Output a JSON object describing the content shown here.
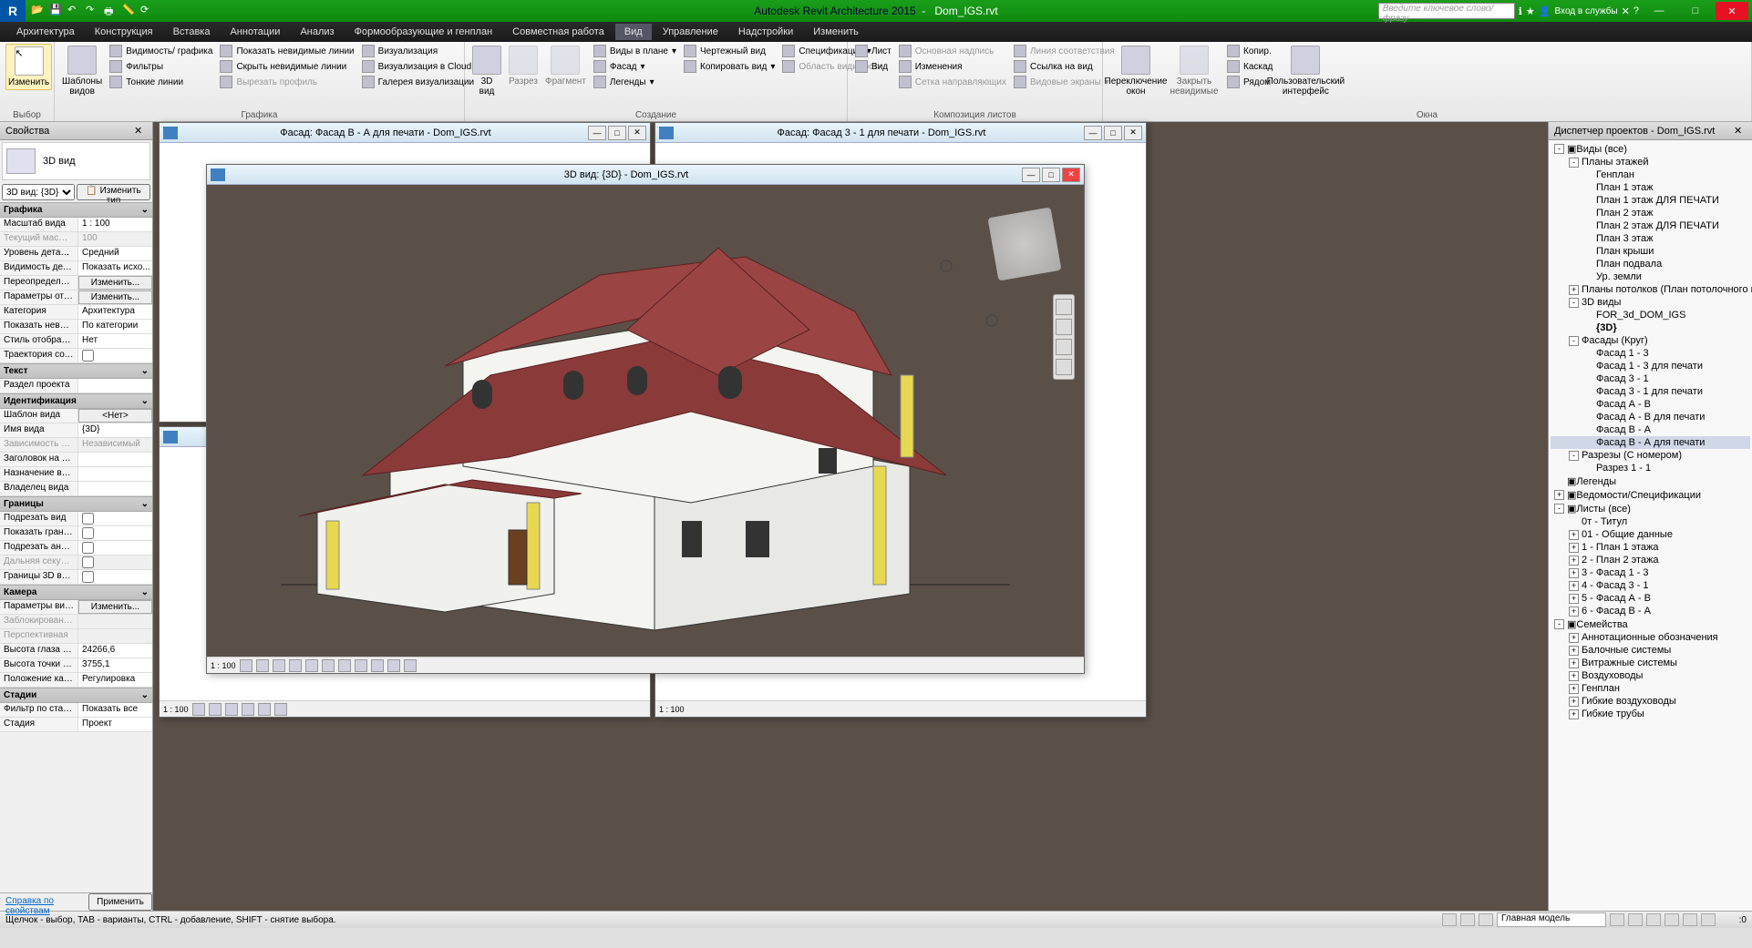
{
  "app": {
    "name": "Autodesk Revit Architecture 2015",
    "file": "Dom_IGS.rvt",
    "search_placeholder": "Введите ключевое слово/фразу",
    "login": "Вход в службы"
  },
  "menu": [
    "Архитектура",
    "Конструкция",
    "Вставка",
    "Аннотации",
    "Анализ",
    "Формообразующие и генплан",
    "Совместная работа",
    "Вид",
    "Управление",
    "Надстройки",
    "Изменить"
  ],
  "menu_active": "Вид",
  "ribbon": {
    "modify": "Изменить",
    "selector_label": "Выбор",
    "templates": "Шаблоны\nвидов",
    "graphics": {
      "label": "Графика",
      "vis_graphics": "Видимость/ графика",
      "filters": "Фильтры",
      "thin_lines": "Тонкие линии",
      "show_hidden": "Показать невидимые линии",
      "hide_hidden": "Скрыть невидимые линии",
      "cut_profile": "Вырезать профиль",
      "visualization": "Визуализация",
      "viz_cloud": "Визуализация  в Cloud",
      "gallery": "Галерея  визуализации"
    },
    "create": {
      "label": "Создание",
      "3d": "3D\nвид",
      "section": "Разрез",
      "fragment": "Фрагмент",
      "plan_views": "Виды в плане",
      "facade": "Фасад",
      "legends": "Легенды",
      "drafting": "Чертежный вид",
      "copy_view": "Копировать вид",
      "schedules": "Спецификации",
      "scope_box": "Область видимости"
    },
    "sheets": {
      "label": "Композиция листов",
      "sheet": "Лист",
      "view": "Вид",
      "title_block": "Основная надпись",
      "revisions": "Изменения",
      "guide_grid": "Сетка направляющих",
      "match_line": "Линия соответствия",
      "view_ref": "Ссылка на вид",
      "viewports": "Видовые экраны"
    },
    "windows": {
      "label": "Окна",
      "switch": "Переключение\nокон",
      "close_hidden": "Закрыть\nневидимые",
      "replicate": "Копир.",
      "cascade": "Каскад",
      "tile": "Рядом",
      "ui": "Пользовательский\nинтерфейс"
    }
  },
  "props": {
    "title": "Свойства",
    "type_name": "3D вид",
    "view_selector": "3D вид: {3D}",
    "edit_type": "Изменить тип",
    "sections": {
      "graphics": "Графика",
      "text": "Текст",
      "ident": "Идентификация",
      "extents": "Границы",
      "camera": "Камера",
      "stages": "Стадии"
    },
    "rows": [
      {
        "s": "graphics",
        "k": "Масштаб вида",
        "v": "1 : 100"
      },
      {
        "s": "graphics",
        "k": "Текущий масшт...",
        "v": "100",
        "d": true
      },
      {
        "s": "graphics",
        "k": "Уровень детали...",
        "v": "Средний"
      },
      {
        "s": "graphics",
        "k": "Видимость дета...",
        "v": "Показать исхо..."
      },
      {
        "s": "graphics",
        "k": "Переопределен...",
        "v": "Изменить...",
        "btn": true
      },
      {
        "s": "graphics",
        "k": "Параметры ото...",
        "v": "Изменить...",
        "btn": true
      },
      {
        "s": "graphics",
        "k": "Категория",
        "v": "Архитектура"
      },
      {
        "s": "graphics",
        "k": "Показать невид...",
        "v": "По категории"
      },
      {
        "s": "graphics",
        "k": "Стиль отображе...",
        "v": "Нет"
      },
      {
        "s": "graphics",
        "k": "Траектория сол...",
        "v": "",
        "cb": true
      },
      {
        "s": "text",
        "k": "Раздел проекта",
        "v": ""
      },
      {
        "s": "ident",
        "k": "Шаблон вида",
        "v": "<Нет>",
        "btn": true
      },
      {
        "s": "ident",
        "k": "Имя вида",
        "v": "{3D}"
      },
      {
        "s": "ident",
        "k": "Зависимость ур...",
        "v": "Независимый",
        "d": true
      },
      {
        "s": "ident",
        "k": "Заголовок на л...",
        "v": ""
      },
      {
        "s": "ident",
        "k": "Назначение вида",
        "v": ""
      },
      {
        "s": "ident",
        "k": "Владелец вида",
        "v": ""
      },
      {
        "s": "extents",
        "k": "Подрезать вид",
        "v": "",
        "cb": true
      },
      {
        "s": "extents",
        "k": "Показать грани...",
        "v": "",
        "cb": true
      },
      {
        "s": "extents",
        "k": "Подрезать анно...",
        "v": "",
        "cb": true
      },
      {
        "s": "extents",
        "k": "Дальняя секущ...",
        "v": "",
        "cb": true,
        "d": true
      },
      {
        "s": "extents",
        "k": "Границы 3D вида",
        "v": "",
        "cb": true
      },
      {
        "s": "camera",
        "k": "Параметры виз...",
        "v": "Изменить...",
        "btn": true
      },
      {
        "s": "camera",
        "k": "Заблокированн...",
        "v": "",
        "d": true
      },
      {
        "s": "camera",
        "k": "Перспективная",
        "v": "",
        "d": true
      },
      {
        "s": "camera",
        "k": "Высота глаза н...",
        "v": "24266,6"
      },
      {
        "s": "camera",
        "k": "Высота точки ц...",
        "v": "3755,1"
      },
      {
        "s": "camera",
        "k": "Положение кам...",
        "v": "Регулировка"
      },
      {
        "s": "stages",
        "k": "Фильтр по стад...",
        "v": "Показать все"
      },
      {
        "s": "stages",
        "k": "Стадия",
        "v": "Проект"
      }
    ],
    "help_link": "Справка по свойствам",
    "apply": "Применить"
  },
  "docs": {
    "facade_b": "Фасад: Фасад В - А для печати - Dom_IGS.rvt",
    "facade_3": "Фасад: Фасад 3 - 1 для печати - Dom_IGS.rvt",
    "view_3d": "3D вид: {3D} - Dom_IGS.rvt",
    "scale": "1 : 100"
  },
  "browser": {
    "title": "Диспетчер проектов - Dom_IGS.rvt",
    "tree": [
      {
        "l": 0,
        "t": "-",
        "label": "Виды (все)",
        "icon": true
      },
      {
        "l": 1,
        "t": "-",
        "label": "Планы этажей"
      },
      {
        "l": 2,
        "label": "Генплан"
      },
      {
        "l": 2,
        "label": "План 1 этаж"
      },
      {
        "l": 2,
        "label": "План 1 этаж ДЛЯ ПЕЧАТИ"
      },
      {
        "l": 2,
        "label": "План 2 этаж"
      },
      {
        "l": 2,
        "label": "План 2 этаж ДЛЯ ПЕЧАТИ"
      },
      {
        "l": 2,
        "label": "План 3 этаж"
      },
      {
        "l": 2,
        "label": "План крыши"
      },
      {
        "l": 2,
        "label": "План подвала"
      },
      {
        "l": 2,
        "label": "Ур. земли"
      },
      {
        "l": 1,
        "t": "+",
        "label": "Планы потолков (План потолочного покр"
      },
      {
        "l": 1,
        "t": "-",
        "label": "3D виды"
      },
      {
        "l": 2,
        "label": "FOR_3d_DOM_IGS"
      },
      {
        "l": 2,
        "label": "{3D}",
        "bold": true
      },
      {
        "l": 1,
        "t": "-",
        "label": "Фасады (Круг)"
      },
      {
        "l": 2,
        "label": "Фасад 1 - 3"
      },
      {
        "l": 2,
        "label": "Фасад 1 - 3 для печати"
      },
      {
        "l": 2,
        "label": "Фасад 3 - 1"
      },
      {
        "l": 2,
        "label": "Фасад 3 - 1 для печати"
      },
      {
        "l": 2,
        "label": "Фасад А - В"
      },
      {
        "l": 2,
        "label": "Фасад А - В для печати"
      },
      {
        "l": 2,
        "label": "Фасад В - А"
      },
      {
        "l": 2,
        "label": "Фасад В - А для печати",
        "sel": true
      },
      {
        "l": 1,
        "t": "-",
        "label": "Разрезы (С номером)"
      },
      {
        "l": 2,
        "label": "Разрез 1 - 1"
      },
      {
        "l": 0,
        "label": "Легенды",
        "icon": true
      },
      {
        "l": 0,
        "t": "+",
        "label": "Ведомости/Спецификации",
        "icon": true
      },
      {
        "l": 0,
        "t": "-",
        "label": "Листы (все)",
        "icon": true
      },
      {
        "l": 1,
        "label": "0т - Титул"
      },
      {
        "l": 1,
        "t": "+",
        "label": "01 - Общие данные"
      },
      {
        "l": 1,
        "t": "+",
        "label": "1 - План 1 этажа"
      },
      {
        "l": 1,
        "t": "+",
        "label": "2 - План 2 этажа"
      },
      {
        "l": 1,
        "t": "+",
        "label": "3 - Фасад 1 - 3"
      },
      {
        "l": 1,
        "t": "+",
        "label": "4 - Фасад 3 - 1"
      },
      {
        "l": 1,
        "t": "+",
        "label": "5 - Фасад А - В"
      },
      {
        "l": 1,
        "t": "+",
        "label": "6 - Фасад В - А"
      },
      {
        "l": 0,
        "t": "-",
        "label": "Семейства",
        "icon": true
      },
      {
        "l": 1,
        "t": "+",
        "label": "Аннотационные обозначения"
      },
      {
        "l": 1,
        "t": "+",
        "label": "Балочные системы"
      },
      {
        "l": 1,
        "t": "+",
        "label": "Витражные системы"
      },
      {
        "l": 1,
        "t": "+",
        "label": "Воздуховоды"
      },
      {
        "l": 1,
        "t": "+",
        "label": "Генплан"
      },
      {
        "l": 1,
        "t": "+",
        "label": "Гибкие воздуховоды"
      },
      {
        "l": 1,
        "t": "+",
        "label": "Гибкие трубы"
      }
    ]
  },
  "status": {
    "text": "Щелчок - выбор, TAB - варианты, CTRL - добавление, SHIFT - снятие выбора.",
    "model": "Главная модель"
  }
}
